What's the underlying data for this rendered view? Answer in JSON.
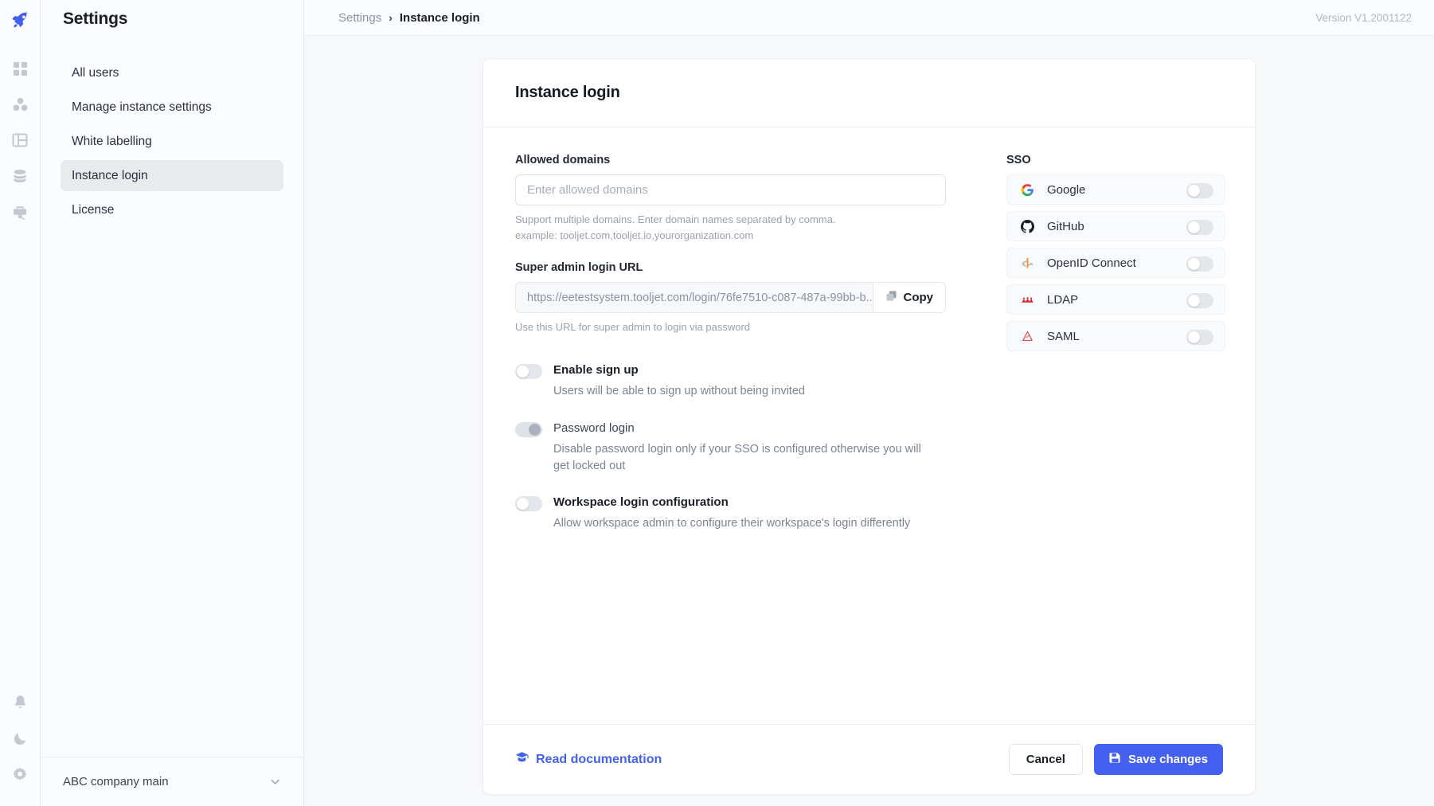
{
  "brand": {
    "logo_icon": "rocket-icon",
    "accent_color": "#4361ee"
  },
  "rail": {
    "items": [
      {
        "icon": "dashboard-grid-icon"
      },
      {
        "icon": "workspace-constants-icon"
      },
      {
        "icon": "table-layout-icon"
      },
      {
        "icon": "database-stack-icon"
      },
      {
        "icon": "marketplace-briefcase-icon"
      }
    ],
    "bottom_items": [
      {
        "icon": "notification-bell-icon"
      },
      {
        "icon": "dark-mode-moon-icon"
      },
      {
        "icon": "settings-gear-icon"
      }
    ]
  },
  "sidebar": {
    "title": "Settings",
    "items": [
      {
        "label": "All users",
        "active": false
      },
      {
        "label": "Manage instance settings",
        "active": false
      },
      {
        "label": "White labelling",
        "active": false
      },
      {
        "label": "Instance login",
        "active": true
      },
      {
        "label": "License",
        "active": false
      }
    ],
    "workspace": {
      "name": "ABC company main",
      "chevron_icon": "chevron-down-icon"
    }
  },
  "topbar": {
    "breadcrumb": {
      "parent": "Settings",
      "separator": "›",
      "current": "Instance login"
    },
    "version": "Version V1.2001122"
  },
  "card": {
    "title": "Instance login",
    "allowed_domains": {
      "label": "Allowed domains",
      "value": "",
      "placeholder": "Enter allowed domains",
      "hint": "Support multiple domains. Enter domain names separated by comma. example: tooljet.com,tooljet.io,yourorganization.com"
    },
    "super_admin_url": {
      "label": "Super admin login URL",
      "value": "https://eetestsystem.tooljet.com/login/76fe7510-c087-487a-99bb-b...",
      "copy_label": "Copy",
      "copy_icon": "copy-icon",
      "hint": "Use this URL for super admin to login via password"
    },
    "switches": [
      {
        "title": "Enable sign up",
        "desc": "Users will be able to sign up without being invited",
        "state": "off"
      },
      {
        "title": "Password login",
        "desc": "Disable password login only if your SSO is configured otherwise you will get locked out",
        "state": "on-disabled"
      },
      {
        "title": "Workspace login configuration",
        "desc": "Allow workspace admin to configure their workspace's login differently",
        "state": "off"
      }
    ],
    "sso": {
      "label": "SSO",
      "providers": [
        {
          "name": "Google",
          "icon": "google-icon",
          "state": "off"
        },
        {
          "name": "GitHub",
          "icon": "github-icon",
          "state": "off"
        },
        {
          "name": "OpenID Connect",
          "icon": "openid-icon",
          "state": "off"
        },
        {
          "name": "LDAP",
          "icon": "ldap-icon",
          "state": "off"
        },
        {
          "name": "SAML",
          "icon": "saml-icon",
          "state": "off"
        }
      ]
    },
    "footer": {
      "doc_link": "Read documentation",
      "doc_icon": "graduation-cap-icon",
      "cancel_label": "Cancel",
      "save_label": "Save changes",
      "save_icon": "save-disk-icon"
    }
  }
}
